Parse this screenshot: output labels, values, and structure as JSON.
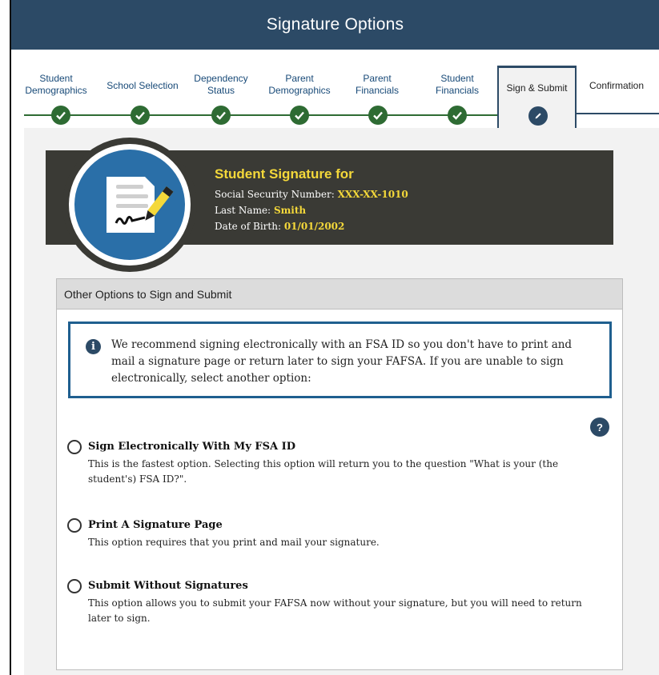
{
  "header": {
    "title": "Signature Options"
  },
  "steps": [
    {
      "label_line1": "Student",
      "label_line2": "Demographics"
    },
    {
      "label_line1": "School Selection",
      "label_line2": ""
    },
    {
      "label_line1": "Dependency",
      "label_line2": "Status"
    },
    {
      "label_line1": "Parent",
      "label_line2": "Demographics"
    },
    {
      "label_line1": "Parent",
      "label_line2": "Financials"
    },
    {
      "label_line1": "Student",
      "label_line2": "Financials"
    }
  ],
  "active_step": {
    "label": "Sign & Submit"
  },
  "final_step": {
    "label": "Confirmation"
  },
  "signature": {
    "title": "Student Signature for",
    "ssn_label": "Social Security Number:",
    "ssn_value": "XXX-XX-1010",
    "last_name_label": "Last Name:",
    "last_name_value": "Smith",
    "dob_label": "Date of Birth:",
    "dob_value": "01/01/2002"
  },
  "panel": {
    "heading": "Other Options to Sign and Submit",
    "info_text": "We recommend signing electronically with an FSA ID so you don't have to print and mail a signature page or return later to sign your FAFSA. If you are unable to sign electronically, select another option:",
    "help_symbol": "?"
  },
  "options": [
    {
      "title": "Sign Electronically With My FSA ID",
      "description": "This is the fastest option. Selecting this option will return you to the question \"What is your (the student's) FSA ID?\"."
    },
    {
      "title": "Print A Signature Page",
      "description": "This option requires that you print and mail your signature."
    },
    {
      "title": "Submit Without Signatures",
      "description": "This option allows you to submit your FAFSA now without your signature, but you will need to return later to sign."
    }
  ]
}
